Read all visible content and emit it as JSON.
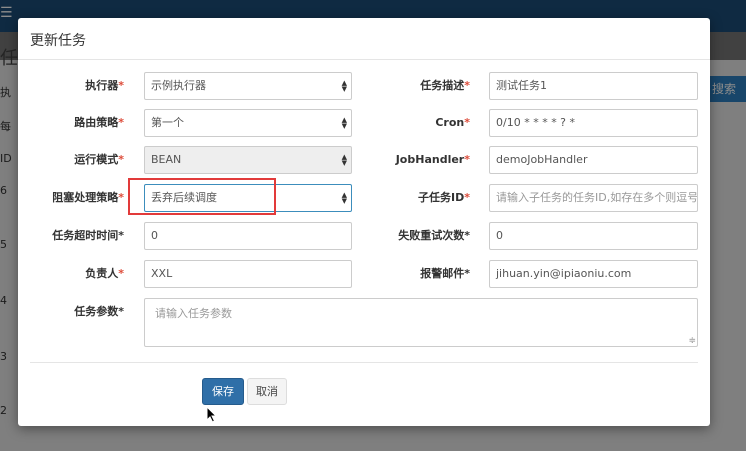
{
  "background": {
    "menu_icon": "menu-icon",
    "title_fragment": "任",
    "tab_fragment": "执",
    "search_label": "搜索",
    "row_label_fragment": "每",
    "col_fragment": "ID",
    "row_ids": [
      "6",
      "5",
      "4",
      "3",
      "2"
    ]
  },
  "modal": {
    "title": "更新任务",
    "fields": {
      "executor": {
        "label": "执行器",
        "star": "*",
        "value": "示例执行器"
      },
      "description": {
        "label": "任务描述",
        "star": "*",
        "value": "测试任务1"
      },
      "route": {
        "label": "路由策略",
        "star": "*",
        "value": "第一个"
      },
      "cron": {
        "label": "Cron",
        "star": "*",
        "value": "0/10 * * * * ? *"
      },
      "run_mode": {
        "label": "运行模式",
        "star": "*",
        "value": "BEAN"
      },
      "job_handler": {
        "label": "JobHandler",
        "star": "*",
        "value": "demoJobHandler"
      },
      "block_strategy": {
        "label": "阻塞处理策略",
        "star": "*",
        "value": "丢弃后续调度"
      },
      "child_job_id": {
        "label": "子任务ID",
        "star": "*",
        "placeholder": "请输入子任务的任务ID,如存在多个则逗号"
      },
      "timeout": {
        "label": "任务超时时间",
        "star": "*",
        "value": "0"
      },
      "retry": {
        "label": "失败重试次数",
        "star": "*",
        "value": "0"
      },
      "owner": {
        "label": "负责人",
        "star": "*",
        "value": "XXL"
      },
      "alarm_email": {
        "label": "报警邮件",
        "star": "*",
        "value": "jihuan.yin@ipiaoniu.com"
      },
      "params": {
        "label": "任务参数",
        "star": "*",
        "placeholder": "请输入任务参数"
      }
    },
    "buttons": {
      "save": "保存",
      "cancel": "取消"
    }
  },
  "colors": {
    "topbar": "#1d4e79",
    "required_star": "#dd4b39",
    "primary_button": "#2f6fa8",
    "highlight": "#e23a3a"
  }
}
